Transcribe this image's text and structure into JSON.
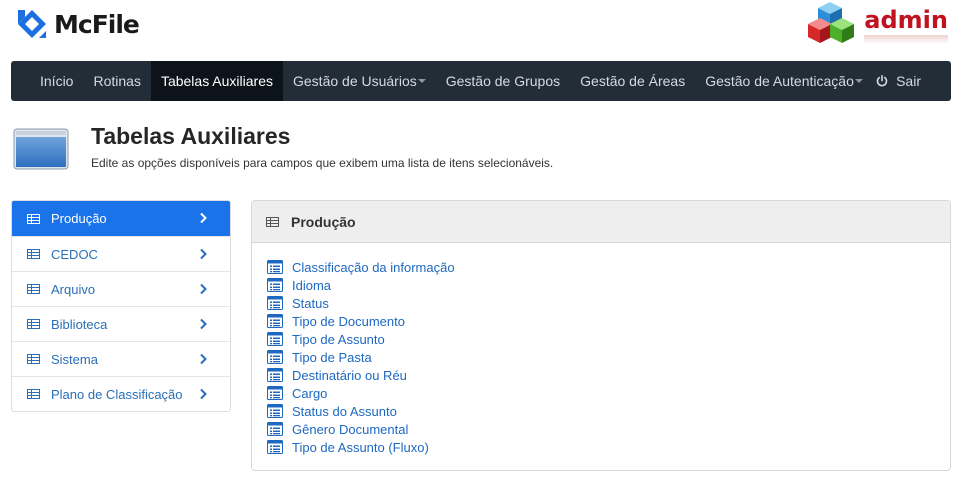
{
  "header": {
    "brand": "McFile",
    "admin_label": "admin"
  },
  "navbar": {
    "items": [
      {
        "label": "Início",
        "dropdown": false,
        "active": false
      },
      {
        "label": "Rotinas",
        "dropdown": false,
        "active": false
      },
      {
        "label": "Tabelas Auxiliares",
        "dropdown": false,
        "active": true
      },
      {
        "label": "Gestão de Usuários",
        "dropdown": true,
        "active": false
      },
      {
        "label": "Gestão de Grupos",
        "dropdown": false,
        "active": false
      },
      {
        "label": "Gestão de Áreas",
        "dropdown": false,
        "active": false
      },
      {
        "label": "Gestão de Autenticação",
        "dropdown": true,
        "active": false
      }
    ],
    "logout_label": "Sair"
  },
  "page": {
    "title": "Tabelas Auxiliares",
    "subtitle": "Edite as opções disponíveis para campos que exibem uma lista de itens selecionáveis."
  },
  "sidebar": {
    "items": [
      {
        "label": "Produção",
        "active": true
      },
      {
        "label": "CEDOC",
        "active": false
      },
      {
        "label": "Arquivo",
        "active": false
      },
      {
        "label": "Biblioteca",
        "active": false
      },
      {
        "label": "Sistema",
        "active": false
      },
      {
        "label": "Plano de Classificação",
        "active": false
      }
    ]
  },
  "panel": {
    "title": "Produção",
    "items": [
      "Classificação da informação",
      "Idioma",
      "Status",
      "Tipo de Documento",
      "Tipo de Assunto",
      "Tipo de Pasta",
      "Destinatário ou Réu",
      "Cargo",
      "Status do Assunto",
      "Gênero Documental",
      "Tipo de Assunto (Fluxo)"
    ]
  },
  "colors": {
    "navbar_bg": "#222d38",
    "nav_active_bg": "#0d131a",
    "accent": "#1a73e8",
    "link": "#1e68c2",
    "admin_red": "#c1121f"
  },
  "icons": {
    "brand": "mcfile-logo-icon",
    "admin": "cubes-icon",
    "logout": "power-icon",
    "page": "window-icon",
    "table": "table-icon",
    "chevron": "chevron-right-icon",
    "list": "list-icon"
  }
}
